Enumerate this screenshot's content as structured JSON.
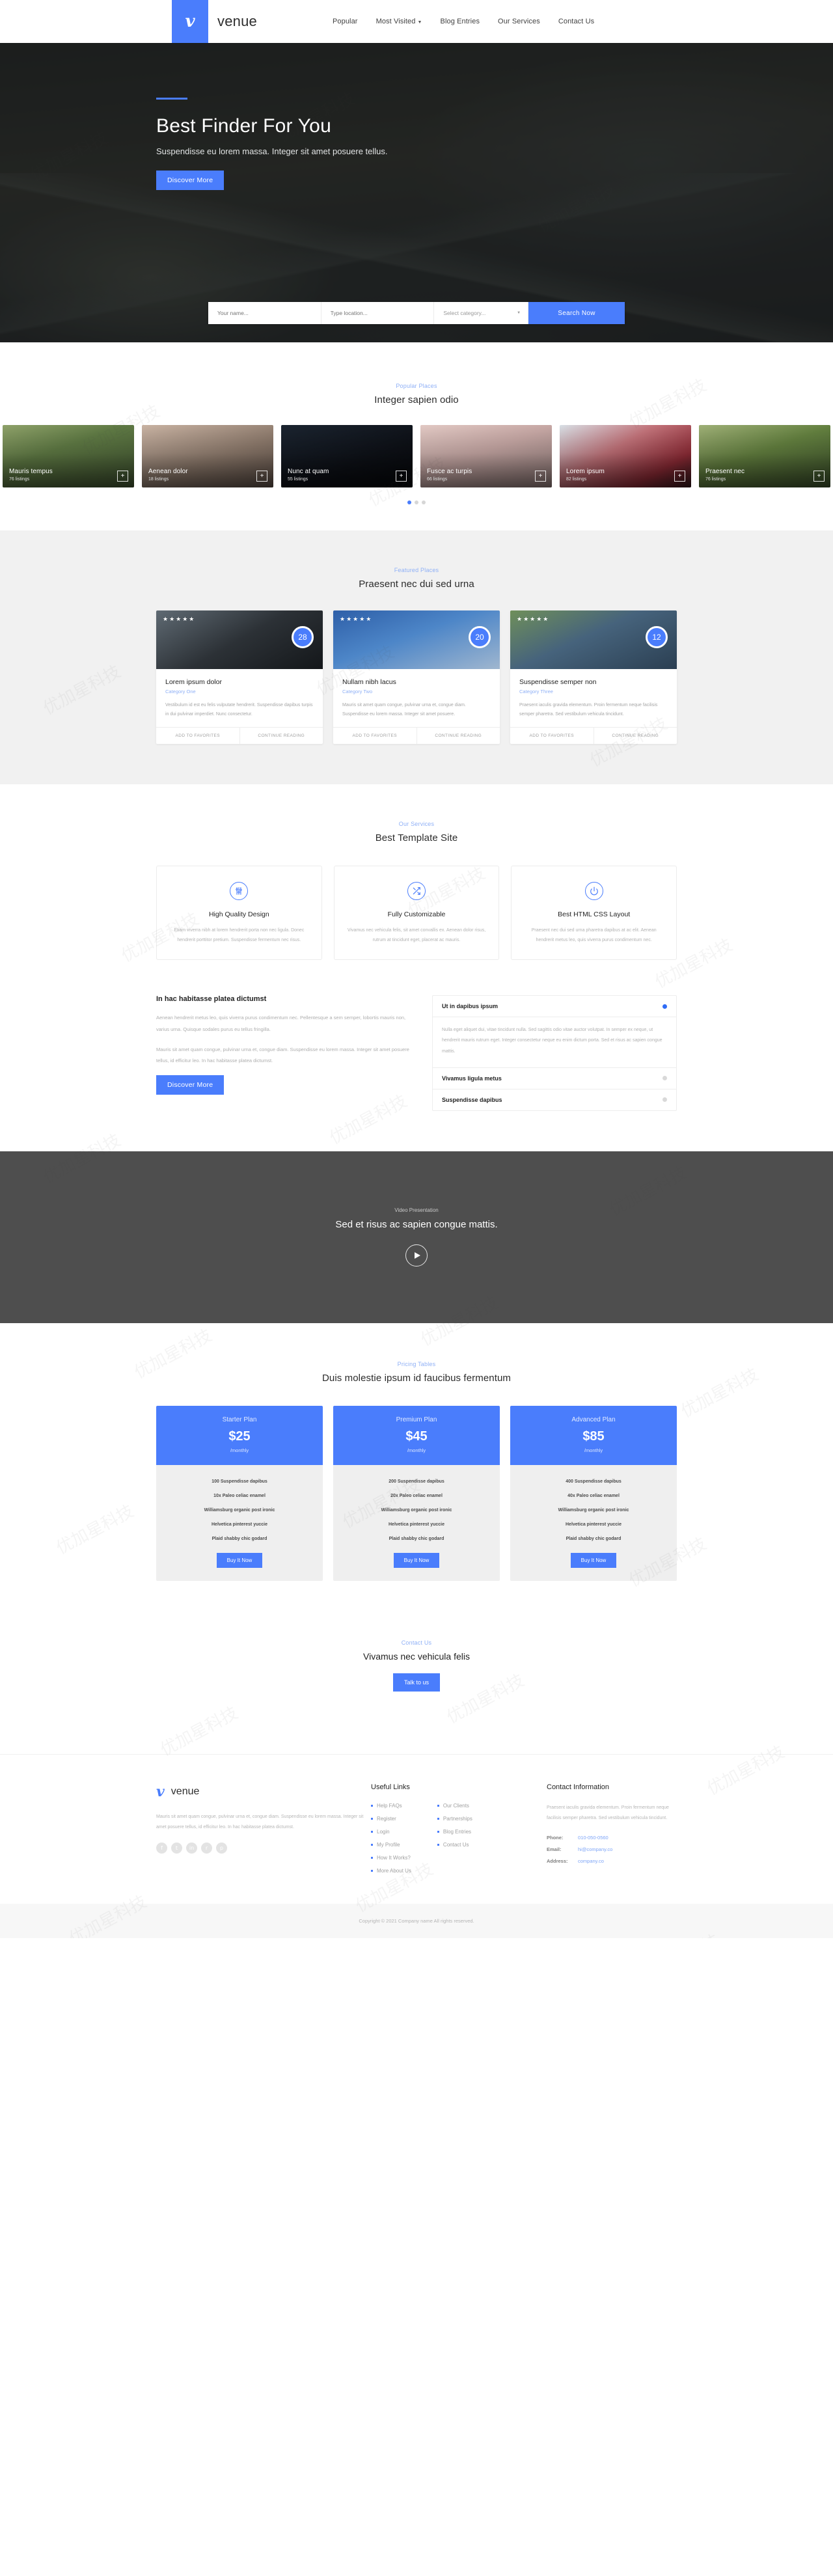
{
  "header": {
    "brand_mark": "v",
    "brand_name": "venue",
    "nav": [
      {
        "label": "Popular",
        "caret": false
      },
      {
        "label": "Most Visited",
        "caret": true
      },
      {
        "label": "Blog Entries",
        "caret": false
      },
      {
        "label": "Our Services",
        "caret": false
      },
      {
        "label": "Contact Us",
        "caret": false
      }
    ]
  },
  "hero": {
    "title": "Best Finder For You",
    "subtitle": "Suspendisse eu lorem massa. Integer sit amet posuere tellus.",
    "button": "Discover More"
  },
  "search": {
    "name_placeholder": "Your name...",
    "location_placeholder": "Type location...",
    "category_value": "Select category...",
    "button": "Search Now"
  },
  "popular": {
    "eyebrow": "Popular Places",
    "title": "Integer sapien odio",
    "places": [
      {
        "name": "Mauris tempus",
        "count": "76 listings"
      },
      {
        "name": "Aenean dolor",
        "count": "18 listings"
      },
      {
        "name": "Nunc at quam",
        "count": "55 listings"
      },
      {
        "name": "Fusce ac turpis",
        "count": "66 listings"
      },
      {
        "name": "Lorem ipsum",
        "count": "82 listings"
      },
      {
        "name": "Praesent nec",
        "count": "76 listings"
      }
    ],
    "dots": 3,
    "active_dot": 0
  },
  "featured": {
    "eyebrow": "Featured Places",
    "title": "Praesent nec dui sed urna",
    "cards": [
      {
        "stars": "★★★★★",
        "badge": "28",
        "title": "Lorem ipsum dolor",
        "category": "Category One",
        "text": "Vestibulum id est eu felis vulputate hendrerit. Suspendisse dapibus turpis in dui pulvinar imperdiet. Nunc consectetur.",
        "action_fav": "ADD TO FAVORITES",
        "action_read": "CONTINUE READING"
      },
      {
        "stars": "★★★★★",
        "badge": "20",
        "title": "Nullam nibh lacus",
        "category": "Category Two",
        "text": "Mauris sit amet quam congue, pulvinar urna et, congue diam. Suspendisse eu lorem massa. Integer sit amet posuere.",
        "action_fav": "ADD TO FAVORITES",
        "action_read": "CONTINUE READING"
      },
      {
        "stars": "★★★★★",
        "badge": "12",
        "title": "Suspendisse semper non",
        "category": "Category Three",
        "text": "Praesent iaculis gravida elementum. Proin fermentum neque facilisis semper pharetra. Sed vestibulum vehicula tincidunt.",
        "action_fav": "ADD TO FAVORITES",
        "action_read": "CONTINUE READING"
      }
    ]
  },
  "services": {
    "eyebrow": "Our Services",
    "title": "Best Template Site",
    "cards": [
      {
        "icon": "sliders-icon",
        "title": "High Quality Design",
        "text": "Etiam viverra nibh at lorem hendrerit porta non nec ligula. Donec hendrerit porttitor pretium. Suspendisse fermentum nec risus."
      },
      {
        "icon": "shuffle-icon",
        "title": "Fully Customizable",
        "text": "Vivamus nec vehicula felis, sit amet convallis ex. Aenean dolor risus, rutrum at tincidunt eget, placerat ac mauris."
      },
      {
        "icon": "power-icon",
        "title": "Best HTML CSS Layout",
        "text": "Praesent nec dui sed urna pharetra dapibus at ac elit. Aenean hendrerit metus leo, quis viverra purus condimentum nec."
      }
    ]
  },
  "split": {
    "title": "In hac habitasse platea dictumst",
    "p1": "Aenean hendrerit metus leo, quis viverra purus condimentum nec. Pellentesque a sem semper, lobortis mauris non, varius urna. Quisque sodales purus eu tellus fringilla.",
    "p2": "Mauris sit amet quam congue, pulvinar urna et, congue diam. Suspendisse eu lorem massa. Integer sit amet posuere tellus, id efficitur leo. In hac habitasse platea dictumst.",
    "button": "Discover More",
    "accordion": [
      {
        "label": "Ut in dapibus ipsum",
        "open": true,
        "body": "Nulla eget aliquet dui, vitae tincidunt nulla. Sed sagittis odio vitae auctor volutpat. In semper ex neque, ut hendrerit mauris rutrum eget. Integer consectetur neque eu enim dictum porta. Sed et risus ac sapien congue mattis."
      },
      {
        "label": "Vivamus ligula metus",
        "open": false,
        "body": ""
      },
      {
        "label": "Suspendisse dapibus",
        "open": false,
        "body": ""
      }
    ]
  },
  "video": {
    "eyebrow": "Video Presentation",
    "title": "Sed et risus ac sapien congue mattis.",
    "play": "play-icon"
  },
  "pricing": {
    "eyebrow": "Pricing Tables",
    "title": "Duis molestie ipsum id faucibus fermentum",
    "plans": [
      {
        "name": "Starter Plan",
        "price": "$25",
        "period": "/monthly",
        "features": [
          "100 Suspendisse dapibus",
          "10x Paleo celiac enamel",
          "Williamsburg organic post ironic",
          "Helvetica pinterest yuccie",
          "Plaid shabby chic godard"
        ],
        "button": "Buy It Now"
      },
      {
        "name": "Premium Plan",
        "price": "$45",
        "period": "/monthly",
        "features": [
          "200 Suspendisse dapibus",
          "20x Paleo celiac enamel",
          "Williamsburg organic post ironic",
          "Helvetica pinterest yuccie",
          "Plaid shabby chic godard"
        ],
        "button": "Buy It Now"
      },
      {
        "name": "Advanced Plan",
        "price": "$85",
        "period": "/monthly",
        "features": [
          "400 Suspendisse dapibus",
          "40x Paleo celiac enamel",
          "Williamsburg organic post ironic",
          "Helvetica pinterest yuccie",
          "Plaid shabby chic godard"
        ],
        "button": "Buy It Now"
      }
    ]
  },
  "cta": {
    "eyebrow": "Contact Us",
    "title": "Vivamus nec vehicula felis",
    "button": "Talk to us"
  },
  "footer": {
    "brand_mark": "v",
    "brand_name": "venue",
    "about": "Mauris sit amet quam congue, pulvinar urna et, congue diam. Suspendisse eu lorem massa. Integer sit amet posuere tellus, id efficitur leo. In hac habitasse platea dictumst.",
    "socials": [
      "f",
      "t",
      "in",
      "r",
      "p"
    ],
    "links_title": "Useful Links",
    "links_col1": [
      "Help FAQs",
      "Register",
      "Login",
      "My Profile",
      "How It Works?",
      "More About Us"
    ],
    "links_col2": [
      "Our Clients",
      "Partnerships",
      "Blog Entries",
      "Contact Us"
    ],
    "contact_title": "Contact Information",
    "contact_text": "Praesent iaculis gravida elementum. Proin fermentum neque facilisis semper pharetra. Sed vestibulum vehicula tincidunt.",
    "contact_rows": [
      {
        "key": "Phone:",
        "val": "010-050-0560"
      },
      {
        "key": "Email:",
        "val": "hi@company.co"
      },
      {
        "key": "Address:",
        "val": "company.co"
      }
    ],
    "copyright": "Copyright © 2021 Company name All rights reserved."
  },
  "colors": {
    "accent": "#4a7dfc",
    "eyebrow": "#8fb0f6",
    "video_bg": "#4e4e4e",
    "featured_bg": "#f1f1f1"
  }
}
